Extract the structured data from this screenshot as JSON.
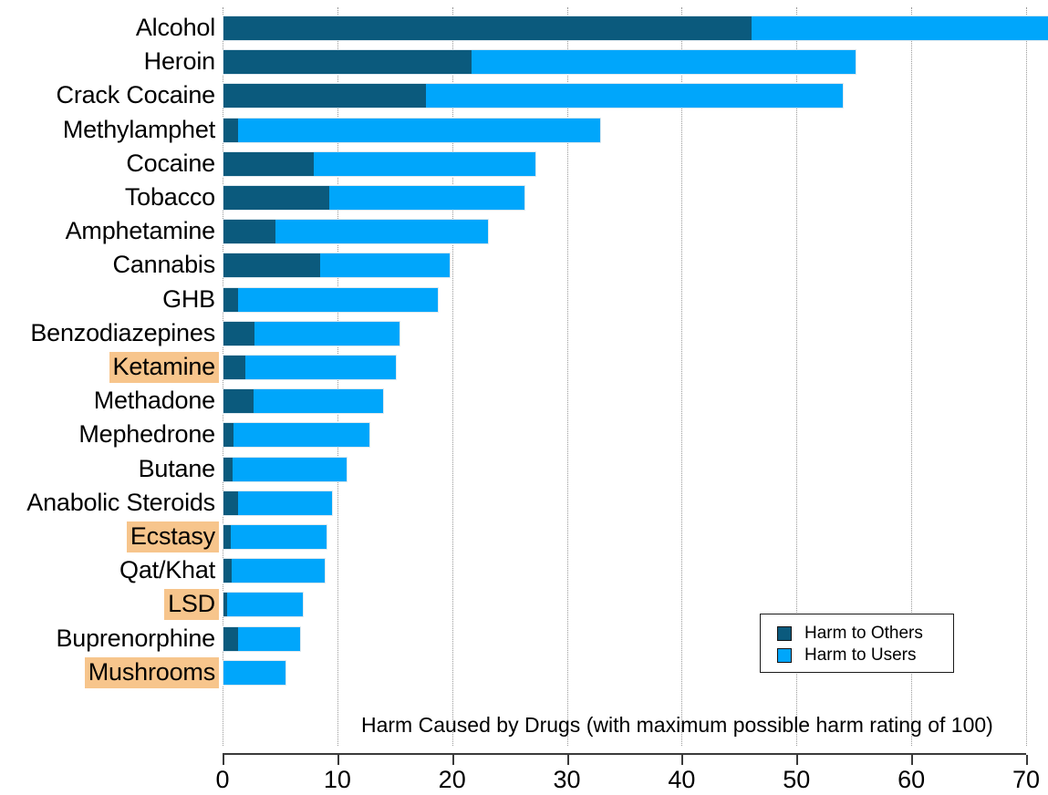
{
  "chart_data": {
    "type": "bar",
    "orientation": "horizontal",
    "stacked": true,
    "title": "",
    "xlabel": "Harm Caused by Drugs (with maximum possible harm rating of 100)",
    "ylabel": "",
    "xlim": [
      0,
      70
    ],
    "xticks": [
      0,
      10,
      20,
      30,
      40,
      50,
      60,
      70
    ],
    "xtick_labels": [
      "0",
      "10",
      "20",
      "30",
      "40",
      "50",
      "60",
      "70"
    ],
    "grid": true,
    "grid_style": "dotted vertical",
    "legend_position": "bottom-right",
    "categories": [
      "Alcohol",
      "Heroin",
      "Crack Cocaine",
      "Methylamphet",
      "Cocaine",
      "Tobacco",
      "Amphetamine",
      "Cannabis",
      "GHB",
      "Benzodiazepines",
      "Ketamine",
      "Methadone",
      "Mephedrone",
      "Butane",
      "Anabolic Steroids",
      "Ecstasy",
      "Qat/Khat",
      "LSD",
      "Buprenorphine",
      "Mushrooms"
    ],
    "series": [
      {
        "name": "Harm to Others",
        "color": "#0b5a7d",
        "values": [
          46.0,
          21.6,
          17.6,
          1.3,
          7.9,
          9.2,
          4.5,
          8.4,
          1.3,
          2.7,
          1.9,
          2.6,
          0.9,
          0.8,
          1.3,
          0.6,
          0.7,
          0.3,
          1.3,
          0.0
        ]
      },
      {
        "name": "Harm to Users",
        "color": "#00a6fb",
        "values": [
          26.0,
          33.6,
          36.5,
          31.7,
          19.4,
          17.2,
          18.7,
          11.5,
          17.5,
          12.8,
          13.3,
          11.5,
          12.0,
          10.1,
          8.3,
          8.5,
          8.3,
          6.8,
          5.5,
          5.6
        ]
      }
    ],
    "totals": [
      72.0,
      55.2,
      54.1,
      33.0,
      27.3,
      26.4,
      23.2,
      19.9,
      18.8,
      15.5,
      15.2,
      14.1,
      12.9,
      10.9,
      9.6,
      9.1,
      9.0,
      7.1,
      6.8,
      5.6
    ],
    "highlighted_categories": [
      "Ketamine",
      "Ecstasy",
      "LSD",
      "Mushrooms"
    ],
    "highlight_color": "#f7c58c"
  },
  "legend": {
    "items": [
      {
        "label": "Harm to Others",
        "swatch": "others"
      },
      {
        "label": "Harm to Users",
        "swatch": "users"
      }
    ]
  }
}
